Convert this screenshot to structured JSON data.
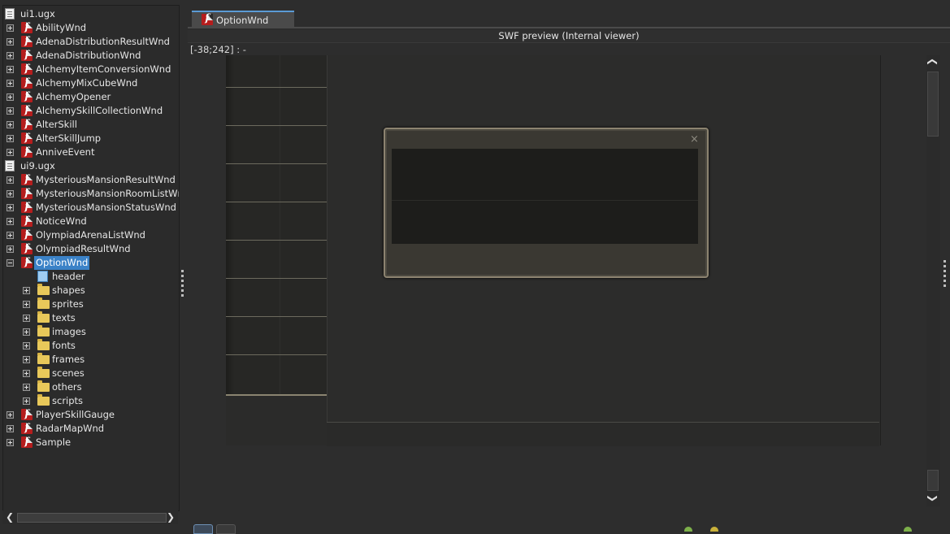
{
  "tree": {
    "rows": [
      {
        "label": "ui1.ugx",
        "level": 0,
        "icon": "file-icon",
        "expand": "minus"
      },
      {
        "label": "AbilityWnd",
        "level": 1,
        "icon": "swf-icon",
        "expand": "plus"
      },
      {
        "label": "AdenaDistributionResultWnd",
        "level": 1,
        "icon": "swf-icon",
        "expand": "plus"
      },
      {
        "label": "AdenaDistributionWnd",
        "level": 1,
        "icon": "swf-icon",
        "expand": "plus"
      },
      {
        "label": "AlchemyItemConversionWnd",
        "level": 1,
        "icon": "swf-icon",
        "expand": "plus"
      },
      {
        "label": "AlchemyMixCubeWnd",
        "level": 1,
        "icon": "swf-icon",
        "expand": "plus"
      },
      {
        "label": "AlchemyOpener",
        "level": 1,
        "icon": "swf-icon",
        "expand": "plus"
      },
      {
        "label": "AlchemySkillCollectionWnd",
        "level": 1,
        "icon": "swf-icon",
        "expand": "plus"
      },
      {
        "label": "AlterSkill",
        "level": 1,
        "icon": "swf-icon",
        "expand": "plus"
      },
      {
        "label": "AlterSkillJump",
        "level": 1,
        "icon": "swf-icon",
        "expand": "plus"
      },
      {
        "label": "AnniveEvent",
        "level": 1,
        "icon": "swf-icon",
        "expand": "plus"
      },
      {
        "label": "ui9.ugx",
        "level": 0,
        "icon": "file-icon",
        "expand": "minus"
      },
      {
        "label": "MysteriousMansionResultWnd",
        "level": 1,
        "icon": "swf-icon",
        "expand": "plus"
      },
      {
        "label": "MysteriousMansionRoomListWnd",
        "level": 1,
        "icon": "swf-icon",
        "expand": "plus"
      },
      {
        "label": "MysteriousMansionStatusWnd",
        "level": 1,
        "icon": "swf-icon",
        "expand": "plus"
      },
      {
        "label": "NoticeWnd",
        "level": 1,
        "icon": "swf-icon",
        "expand": "plus"
      },
      {
        "label": "OlympiadArenaListWnd",
        "level": 1,
        "icon": "swf-icon",
        "expand": "plus"
      },
      {
        "label": "OlympiadResultWnd",
        "level": 1,
        "icon": "swf-icon",
        "expand": "plus"
      },
      {
        "label": "OptionWnd",
        "level": 1,
        "icon": "swf-icon",
        "expand": "minus",
        "selected": true
      },
      {
        "label": "header",
        "level": 2,
        "icon": "document-icon",
        "expand": "none"
      },
      {
        "label": "shapes",
        "level": 2,
        "icon": "folder-icon",
        "expand": "plus"
      },
      {
        "label": "sprites",
        "level": 2,
        "icon": "folder-icon",
        "expand": "plus"
      },
      {
        "label": "texts",
        "level": 2,
        "icon": "folder-icon",
        "expand": "plus"
      },
      {
        "label": "images",
        "level": 2,
        "icon": "folder-icon",
        "expand": "plus"
      },
      {
        "label": "fonts",
        "level": 2,
        "icon": "folder-icon",
        "expand": "plus"
      },
      {
        "label": "frames",
        "level": 2,
        "icon": "folder-icon",
        "expand": "plus"
      },
      {
        "label": "scenes",
        "level": 2,
        "icon": "folder-icon",
        "expand": "plus"
      },
      {
        "label": "others",
        "level": 2,
        "icon": "folder-icon",
        "expand": "plus"
      },
      {
        "label": "scripts",
        "level": 2,
        "icon": "folder-icon",
        "expand": "plus"
      },
      {
        "label": "PlayerSkillGauge",
        "level": 1,
        "icon": "swf-icon",
        "expand": "plus"
      },
      {
        "label": "RadarMapWnd",
        "level": 1,
        "icon": "swf-icon",
        "expand": "plus"
      },
      {
        "label": "Sample",
        "level": 1,
        "icon": "swf-icon",
        "expand": "plus"
      }
    ]
  },
  "tab": {
    "label": "OptionWnd"
  },
  "preview": {
    "title": "SWF preview (Internal viewer)",
    "coords": "[-38;242] :  -"
  },
  "dialog": {
    "close_glyph": "×"
  },
  "colors": {
    "accent": "#3b82c7",
    "swf_red": "#b51d1d",
    "folder": "#e8c85a",
    "frame_gold": "#8c8370"
  }
}
